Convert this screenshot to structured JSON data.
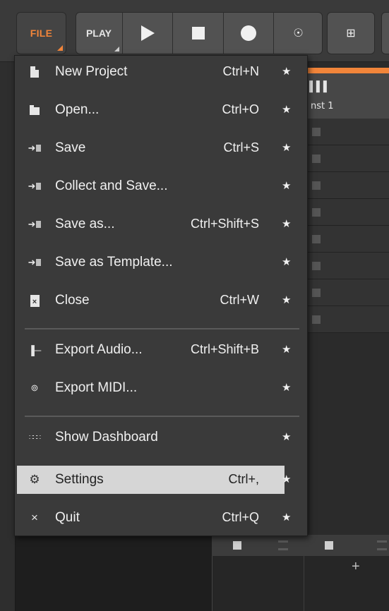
{
  "toolbar": {
    "file_label": "FILE",
    "play_label": "PLAY"
  },
  "track": {
    "name": "nst 1"
  },
  "file_menu": {
    "items": [
      {
        "label": "New Project",
        "shortcut": "Ctrl+N",
        "icon": "new-document-icon"
      },
      {
        "label": "Open...",
        "shortcut": "Ctrl+O",
        "icon": "folder-icon"
      },
      {
        "label": "Save",
        "shortcut": "Ctrl+S",
        "icon": "save-arrow-icon"
      },
      {
        "label": "Collect and Save...",
        "shortcut": "",
        "icon": "collect-save-icon"
      },
      {
        "label": "Save as...",
        "shortcut": "Ctrl+Shift+S",
        "icon": "save-as-icon"
      },
      {
        "label": "Save as Template...",
        "shortcut": "",
        "icon": "save-template-icon"
      },
      {
        "label": "Close",
        "shortcut": "Ctrl+W",
        "icon": "close-document-icon"
      },
      {
        "label": "Export Audio...",
        "shortcut": "Ctrl+Shift+B",
        "icon": "waveform-icon"
      },
      {
        "label": "Export MIDI...",
        "shortcut": "",
        "icon": "midi-icon"
      },
      {
        "label": "Show Dashboard",
        "shortcut": "",
        "icon": "dashboard-icon"
      },
      {
        "label": "Settings",
        "shortcut": "Ctrl+,",
        "icon": "gear-icon",
        "highlighted": true
      },
      {
        "label": "Quit",
        "shortcut": "Ctrl+Q",
        "icon": "x-icon"
      }
    ]
  },
  "colors": {
    "accent": "#f2853a",
    "menu_bg": "#3a3a3a",
    "highlight_bg": "#d6d6d6"
  }
}
